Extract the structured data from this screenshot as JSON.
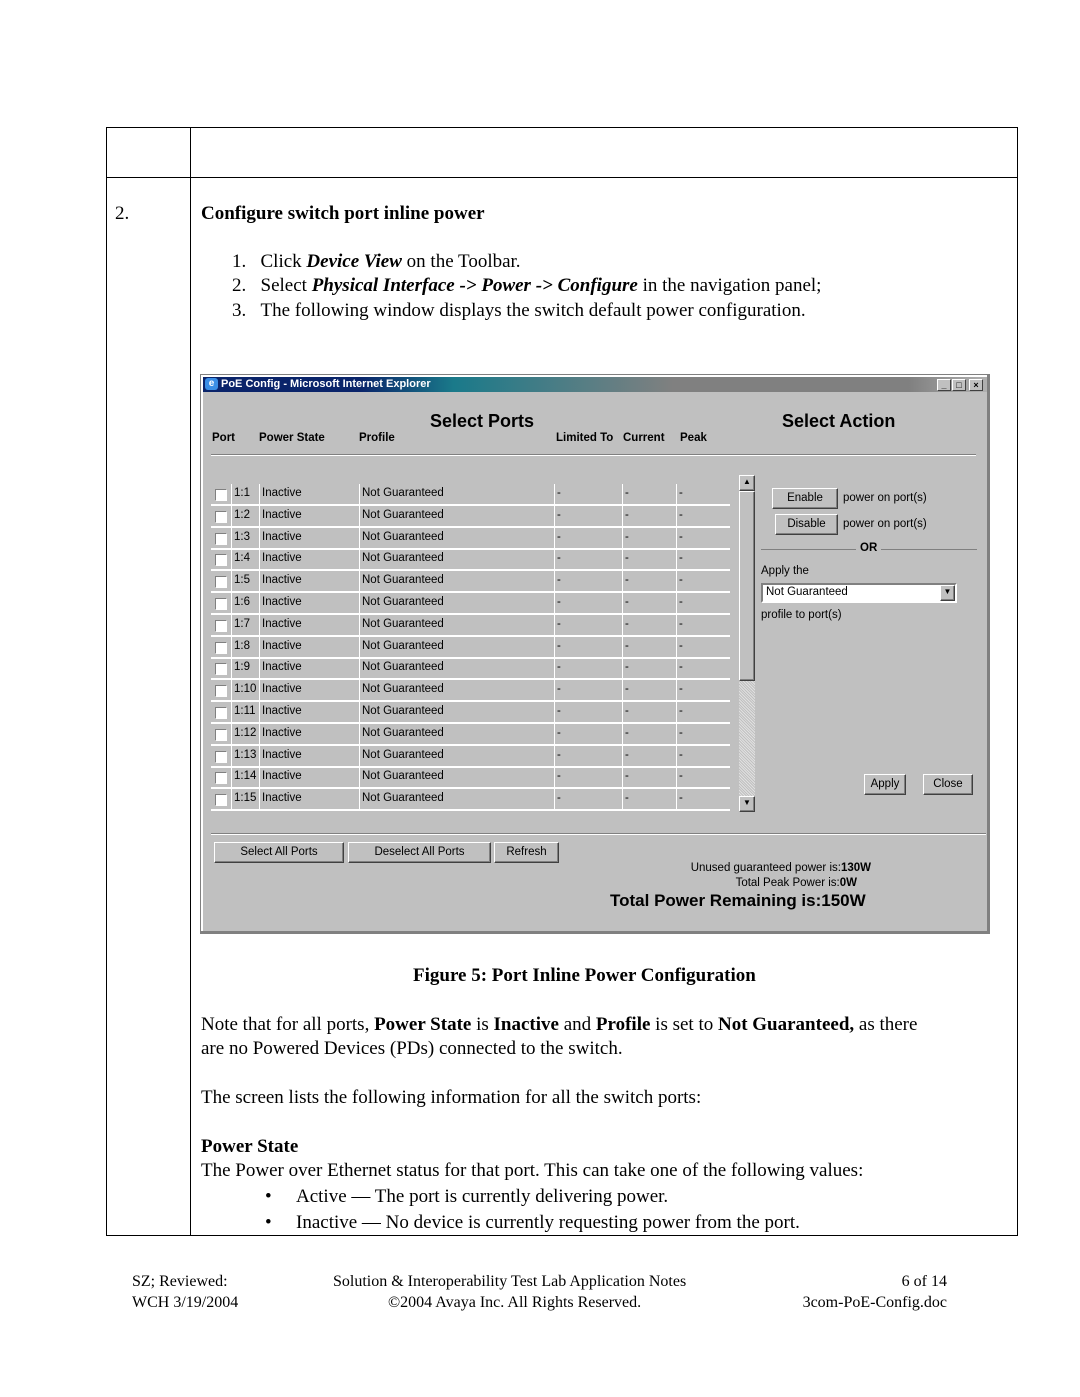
{
  "step": {
    "number": "2.",
    "title": "Configure switch port inline power"
  },
  "instructions": [
    {
      "num": "1.",
      "pre": "Click ",
      "em": "Device View",
      "post": " on the Toolbar."
    },
    {
      "num": "2.",
      "pre": "Select ",
      "em": "Physical Interface -> Power -> Configure",
      "post": " in the navigation panel;"
    },
    {
      "num": "3.",
      "pre": "The following window displays the switch default power configuration.",
      "em": "",
      "post": ""
    }
  ],
  "window": {
    "title": "PoE Config - Microsoft Internet Explorer",
    "select_ports": "Select Ports",
    "select_action": "Select Action",
    "columns": [
      "Port",
      "Power State",
      "Profile",
      "Limited To",
      "Current",
      "Peak"
    ],
    "rows": [
      {
        "port": "1:1",
        "state": "Inactive",
        "profile": "Not Guaranteed",
        "limited": "-",
        "current": "-",
        "peak": "-"
      },
      {
        "port": "1:2",
        "state": "Inactive",
        "profile": "Not Guaranteed",
        "limited": "-",
        "current": "-",
        "peak": "-"
      },
      {
        "port": "1:3",
        "state": "Inactive",
        "profile": "Not Guaranteed",
        "limited": "-",
        "current": "-",
        "peak": "-"
      },
      {
        "port": "1:4",
        "state": "Inactive",
        "profile": "Not Guaranteed",
        "limited": "-",
        "current": "-",
        "peak": "-"
      },
      {
        "port": "1:5",
        "state": "Inactive",
        "profile": "Not Guaranteed",
        "limited": "-",
        "current": "-",
        "peak": "-"
      },
      {
        "port": "1:6",
        "state": "Inactive",
        "profile": "Not Guaranteed",
        "limited": "-",
        "current": "-",
        "peak": "-"
      },
      {
        "port": "1:7",
        "state": "Inactive",
        "profile": "Not Guaranteed",
        "limited": "-",
        "current": "-",
        "peak": "-"
      },
      {
        "port": "1:8",
        "state": "Inactive",
        "profile": "Not Guaranteed",
        "limited": "-",
        "current": "-",
        "peak": "-"
      },
      {
        "port": "1:9",
        "state": "Inactive",
        "profile": "Not Guaranteed",
        "limited": "-",
        "current": "-",
        "peak": "-"
      },
      {
        "port": "1:10",
        "state": "Inactive",
        "profile": "Not Guaranteed",
        "limited": "-",
        "current": "-",
        "peak": "-"
      },
      {
        "port": "1:11",
        "state": "Inactive",
        "profile": "Not Guaranteed",
        "limited": "-",
        "current": "-",
        "peak": "-"
      },
      {
        "port": "1:12",
        "state": "Inactive",
        "profile": "Not Guaranteed",
        "limited": "-",
        "current": "-",
        "peak": "-"
      },
      {
        "port": "1:13",
        "state": "Inactive",
        "profile": "Not Guaranteed",
        "limited": "-",
        "current": "-",
        "peak": "-"
      },
      {
        "port": "1:14",
        "state": "Inactive",
        "profile": "Not Guaranteed",
        "limited": "-",
        "current": "-",
        "peak": "-"
      },
      {
        "port": "1:15",
        "state": "Inactive",
        "profile": "Not Guaranteed",
        "limited": "-",
        "current": "-",
        "peak": "-"
      }
    ],
    "enable": "Enable",
    "disable": "Disable",
    "power_on_ports": "power on port(s)",
    "or": "OR",
    "apply_the": "Apply the",
    "profile_select": "Not Guaranteed",
    "profile_to_ports": "profile to port(s)",
    "apply": "Apply",
    "close": "Close",
    "select_all": "Select All Ports",
    "deselect_all": "Deselect All Ports",
    "refresh": "Refresh",
    "unused_label": "Unused guaranteed power is:",
    "unused_value": "130W",
    "peak_label": "Total Peak Power is:",
    "peak_value": "0W",
    "remaining": "Total Power Remaining is:150W"
  },
  "caption": "Figure 5: Port Inline Power Configuration",
  "note": {
    "t1": "Note that for all ports, ",
    "b1": "Power State",
    "t2": " is ",
    "b2": "Inactive",
    "t3": " and ",
    "b3": "Profile",
    "t4": " is set to ",
    "b4": "Not Guaranteed,",
    "t5": " as there",
    "line2": "are no Powered Devices (PDs) connected to the switch."
  },
  "list_intro": "The screen lists the following information for all the switch ports:",
  "power_state": {
    "heading": "Power State",
    "desc": "The Power over Ethernet status for that port. This can take one of the following values:",
    "bullets": [
      "Active — The port is currently delivering power.",
      "Inactive — No device is currently requesting power from the port."
    ]
  },
  "footer": {
    "left1": "SZ; Reviewed:",
    "left2": "WCH 3/19/2004",
    "center1": "Solution & Interoperability Test Lab Application Notes",
    "center2": "©2004 Avaya Inc. All Rights Reserved.",
    "right1": "6 of 14",
    "right2": "3com-PoE-Config.doc"
  }
}
